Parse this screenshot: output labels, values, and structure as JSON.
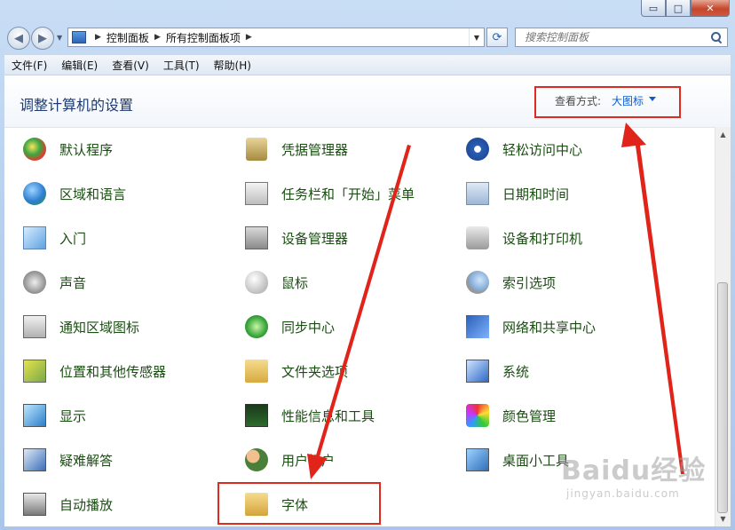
{
  "window": {
    "caption_buttons": {
      "minimize": "▭",
      "maximize": "□",
      "close": "✕"
    }
  },
  "nav": {
    "breadcrumbs": [
      "控制面板",
      "所有控制面板项"
    ],
    "search_placeholder": "搜索控制面板"
  },
  "menu": [
    "文件(F)",
    "编辑(E)",
    "查看(V)",
    "工具(T)",
    "帮助(H)"
  ],
  "header": {
    "title": "调整计算机的设置",
    "view_by_label": "查看方式:",
    "view_by_value": "大图标"
  },
  "items": [
    {
      "label": "默认程序",
      "icon": "default-programs-icon"
    },
    {
      "label": "凭据管理器",
      "icon": "credential-manager-icon"
    },
    {
      "label": "轻松访问中心",
      "icon": "ease-of-access-icon"
    },
    {
      "label": "区域和语言",
      "icon": "region-language-icon"
    },
    {
      "label": "任务栏和「开始」菜单",
      "icon": "taskbar-start-menu-icon"
    },
    {
      "label": "日期和时间",
      "icon": "date-time-icon"
    },
    {
      "label": "入门",
      "icon": "getting-started-icon"
    },
    {
      "label": "设备管理器",
      "icon": "device-manager-icon"
    },
    {
      "label": "设备和打印机",
      "icon": "devices-printers-icon"
    },
    {
      "label": "声音",
      "icon": "sound-icon"
    },
    {
      "label": "鼠标",
      "icon": "mouse-icon"
    },
    {
      "label": "索引选项",
      "icon": "indexing-options-icon"
    },
    {
      "label": "通知区域图标",
      "icon": "notification-area-icon"
    },
    {
      "label": "同步中心",
      "icon": "sync-center-icon"
    },
    {
      "label": "网络和共享中心",
      "icon": "network-sharing-icon"
    },
    {
      "label": "位置和其他传感器",
      "icon": "location-sensors-icon"
    },
    {
      "label": "文件夹选项",
      "icon": "folder-options-icon"
    },
    {
      "label": "系统",
      "icon": "system-icon"
    },
    {
      "label": "显示",
      "icon": "display-icon"
    },
    {
      "label": "性能信息和工具",
      "icon": "performance-icon"
    },
    {
      "label": "颜色管理",
      "icon": "color-management-icon"
    },
    {
      "label": "疑难解答",
      "icon": "troubleshooting-icon"
    },
    {
      "label": "用户帐户",
      "icon": "user-accounts-icon"
    },
    {
      "label": "桌面小工具",
      "icon": "desktop-gadgets-icon"
    },
    {
      "label": "自动播放",
      "icon": "autoplay-icon"
    },
    {
      "label": "字体",
      "icon": "fonts-icon"
    }
  ],
  "watermark": {
    "logo": "Baidu经验",
    "sub": "jingyan.baidu.com"
  },
  "colors": {
    "annotation": "#e02a1e",
    "item_text": "#1a4d12",
    "link": "#0b5ccf"
  }
}
